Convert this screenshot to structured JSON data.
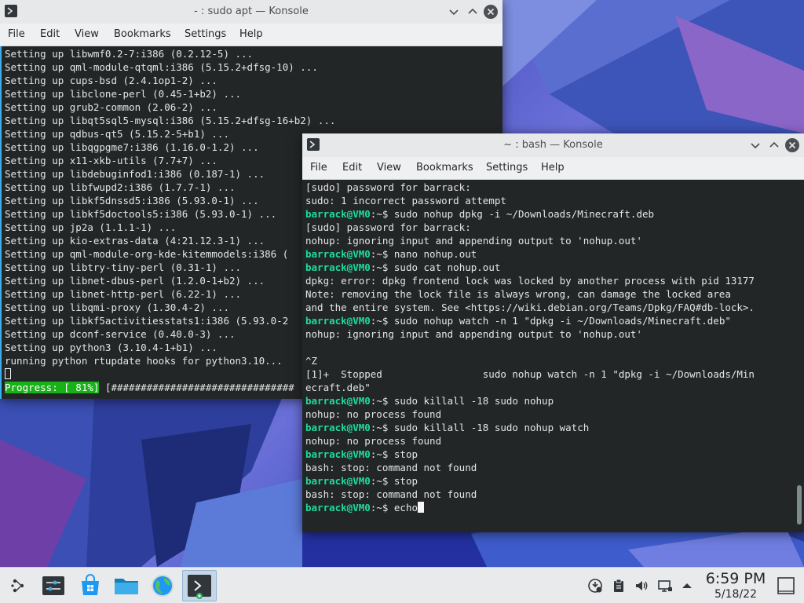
{
  "colors": {
    "prompt": "#1cdc9a",
    "terminal_bg": "#232627",
    "progress_bg": "#18b218",
    "accent": "#3daee9"
  },
  "window_back": {
    "title": "- : sudo apt — Konsole",
    "menu": [
      "File",
      "Edit",
      "View",
      "Bookmarks",
      "Settings",
      "Help"
    ],
    "lines": [
      "Setting up libwmf0.2-7:i386 (0.2.12-5) ...",
      "Setting up qml-module-qtqml:i386 (5.15.2+dfsg-10) ...",
      "Setting up cups-bsd (2.4.1op1-2) ...",
      "Setting up libclone-perl (0.45-1+b2) ...",
      "Setting up grub2-common (2.06-2) ...",
      "Setting up libqt5sql5-mysql:i386 (5.15.2+dfsg-16+b2) ...",
      "Setting up qdbus-qt5 (5.15.2-5+b1) ...",
      "Setting up libqgpgme7:i386 (1.16.0-1.2) ...",
      "Setting up x11-xkb-utils (7.7+7) ...",
      "Setting up libdebuginfod1:i386 (0.187-1) ...",
      "Setting up libfwupd2:i386 (1.7.7-1) ...",
      "Setting up libkf5dnssd5:i386 (5.93.0-1) ...",
      "Setting up libkf5doctools5:i386 (5.93.0-1) ...",
      "Setting up jp2a (1.1.1-1) ...",
      "Setting up kio-extras-data (4:21.12.3-1) ...",
      "Setting up qml-module-org-kde-kitemmodels:i386 (",
      "Setting up libtry-tiny-perl (0.31-1) ...",
      "Setting up libnet-dbus-perl (1.2.0-1+b2) ...",
      "Setting up libnet-http-perl (6.22-1) ...",
      "Setting up libqmi-proxy (1.30.4-2) ...",
      "Setting up libkf5activitiesstats1:i386 (5.93.0-2",
      "Setting up dconf-service (0.40.0-3) ...",
      "Setting up python3 (3.10.4-1+b1) ...",
      "running python rtupdate hooks for python3.10..."
    ],
    "progress_label": "Progress: [ 81%]",
    "progress_bar": " [###############################"
  },
  "window_front": {
    "title": "~ : bash — Konsole",
    "menu": [
      "File",
      "Edit",
      "View",
      "Bookmarks",
      "Settings",
      "Help"
    ],
    "prompt": "barrack@VM0",
    "prompt_suffix": ":~$ ",
    "lines": [
      {
        "text": "[sudo] password for barrack:"
      },
      {
        "text": "sudo: 1 incorrect password attempt"
      },
      {
        "cmd": "sudo nohup dpkg -i ~/Downloads/Minecraft.deb"
      },
      {
        "text": "[sudo] password for barrack:"
      },
      {
        "text": "nohup: ignoring input and appending output to 'nohup.out'"
      },
      {
        "cmd": "nano nohup.out"
      },
      {
        "cmd": "sudo cat nohup.out"
      },
      {
        "text": "dpkg: error: dpkg frontend lock was locked by another process with pid 13177"
      },
      {
        "text": "Note: removing the lock file is always wrong, can damage the locked area"
      },
      {
        "text": "and the entire system. See <https://wiki.debian.org/Teams/Dpkg/FAQ#db-lock>."
      },
      {
        "cmd": "sudo nohup watch -n 1 \"dpkg -i ~/Downloads/Minecraft.deb\""
      },
      {
        "text": "nohup: ignoring input and appending output to 'nohup.out'"
      },
      {
        "text": ""
      },
      {
        "text": "^Z"
      },
      {
        "text": "[1]+  Stopped                 sudo nohup watch -n 1 \"dpkg -i ~/Downloads/Min"
      },
      {
        "text": "ecraft.deb\""
      },
      {
        "cmd": "sudo killall -18 sudo nohup"
      },
      {
        "text": "nohup: no process found"
      },
      {
        "cmd": "sudo killall -18 sudo nohup watch"
      },
      {
        "text": "nohup: no process found"
      },
      {
        "cmd": "stop"
      },
      {
        "text": "bash: stop: command not found"
      },
      {
        "cmd": "stop"
      },
      {
        "text": "bash: stop: command not found"
      },
      {
        "cmd": "echo",
        "cursor": true
      }
    ]
  },
  "taskbar": {
    "items": [
      {
        "name": "app-launcher-icon",
        "label": "Application Launcher"
      },
      {
        "name": "system-settings-icon",
        "label": "System Settings"
      },
      {
        "name": "discover-store-icon",
        "label": "Discover"
      },
      {
        "name": "dolphin-folder-icon",
        "label": "Dolphin"
      },
      {
        "name": "web-browser-icon",
        "label": "Web Browser"
      },
      {
        "name": "konsole-task-icon",
        "label": "Konsole"
      }
    ],
    "tray": [
      "update-notifier-icon",
      "clipboard-icon",
      "volume-icon",
      "network-icon",
      "tray-expand-icon"
    ],
    "clock_time": "6:59 PM",
    "clock_date": "5/18/22",
    "show_desktop": "show-desktop-icon"
  }
}
